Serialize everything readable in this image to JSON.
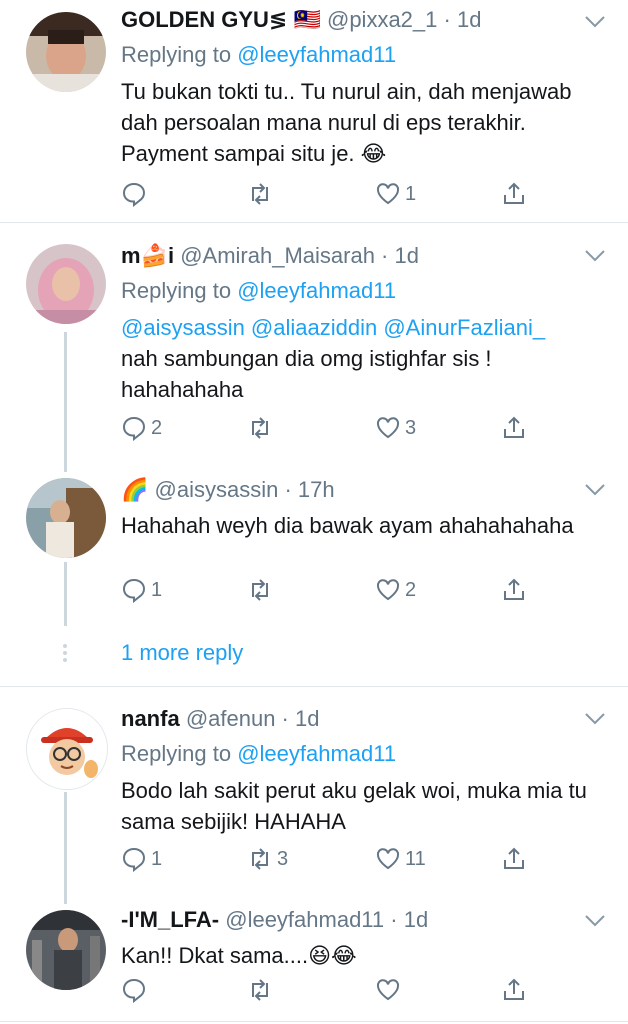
{
  "tweets": [
    {
      "name": "GOLDEN GYU",
      "name_suffix": "≶ 🇲🇾",
      "handle": "@pixxa2_1",
      "time": "1d",
      "replying_label": "Replying to",
      "replying_to": "@leeyfahmad11",
      "text": "Tu bukan tokti tu.. Tu nurul ain, dah menjawab dah persoalan mana nurul di eps terakhir. Payment sampai situ je. 😂",
      "reply_count": "",
      "retweet_count": "",
      "like_count": "1"
    },
    {
      "name": "m🍰i",
      "handle": "@Amirah_Maisarah",
      "time": "1d",
      "replying_label": "Replying to",
      "replying_to": "@leeyfahmad11",
      "mentions": "@aisysassin @aliaaziddin @AinurFazliani_",
      "text": "nah sambungan dia omg istighfar sis ! hahahahaha",
      "reply_count": "2",
      "retweet_count": "",
      "like_count": "3"
    },
    {
      "name": "🌈",
      "handle": "@aisysassin",
      "time": "17h",
      "text": "Hahahah weyh dia bawak ayam ahahahahaha",
      "reply_count": "1",
      "retweet_count": "",
      "like_count": "2"
    },
    {
      "name": "nanfa",
      "handle": "@afenun",
      "time": "1d",
      "replying_label": "Replying to",
      "replying_to": "@leeyfahmad11",
      "text": "Bodo lah sakit perut aku gelak woi, muka mia tu sama sebijik! HAHAHA",
      "reply_count": "1",
      "retweet_count": "3",
      "like_count": "11"
    },
    {
      "name": "-I'M_LFA-",
      "handle": "@leeyfahmad11",
      "time": "1d",
      "text": "Kan!! Dkat sama....😆😂",
      "reply_count": "",
      "retweet_count": "",
      "like_count": ""
    }
  ],
  "more_replies_label": "1 more reply",
  "colors": {
    "link": "#1da1f2",
    "muted": "#657786",
    "text": "#14171a",
    "divider": "#e1e8ed"
  }
}
